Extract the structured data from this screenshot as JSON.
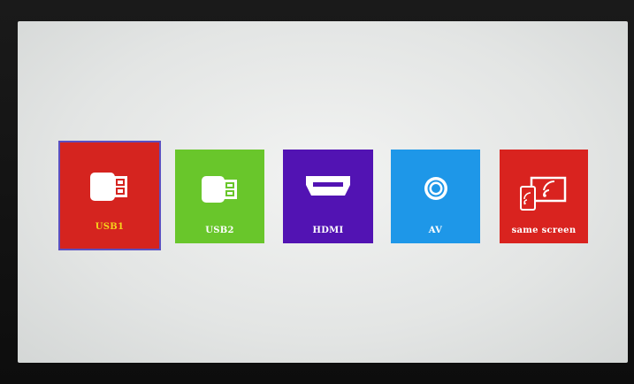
{
  "sources": [
    {
      "id": "usb1",
      "label": "USB1",
      "color": "#d5241f",
      "label_color": "#f5d21c",
      "icon": "usb-drive-icon",
      "selected": true
    },
    {
      "id": "usb2",
      "label": "USB2",
      "color": "#69c62b",
      "label_color": "#ffffff",
      "icon": "usb-drive-icon",
      "selected": false
    },
    {
      "id": "hdmi",
      "label": "HDMI",
      "color": "#5213b3",
      "label_color": "#ffffff",
      "icon": "hdmi-port-icon",
      "selected": false
    },
    {
      "id": "av",
      "label": "AV",
      "color": "#1e97e8",
      "label_color": "#ffffff",
      "icon": "av-jack-icon",
      "selected": false
    },
    {
      "id": "same",
      "label": "same screen",
      "color": "#d9231f",
      "label_color": "#ffffff",
      "icon": "screen-mirror-icon",
      "selected": false
    }
  ],
  "colors": {
    "selection_border": "#5b4fc0",
    "screen_background": "#e6e8e7"
  }
}
